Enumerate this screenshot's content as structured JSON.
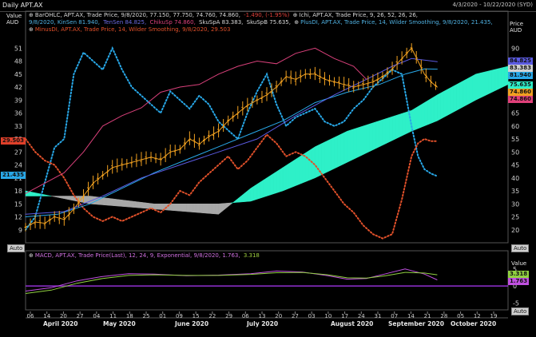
{
  "window": {
    "title": "Daily APT.AX",
    "date_range": "4/3/2020 - 10/22/2020 (SYD)"
  },
  "axes": {
    "left_title": "Value",
    "left_unit": "AUD",
    "right_title": "Price",
    "right_unit": "AUD",
    "macd_right_title": "Value",
    "auto_label": "Auto"
  },
  "legend": {
    "main_line1": [
      {
        "icon": "bar",
        "text": "BarOHLC, APT.AX, Trade Price, 9/8/2020, 77.150, 77.750, 74.760, 74.860, ",
        "color": "#d8d8d8"
      },
      {
        "icon": "none",
        "text": "-1.490, (-1.95%)",
        "color": "#e0403a"
      },
      {
        "icon": "ichi",
        "text": "Ichi, APT.AX, Trade Price,  9, 26, 52, 26, 26,",
        "color": "#d8d8d8"
      }
    ],
    "main_line2": [
      {
        "text": "9/8/2020, KinSen 81.940,",
        "color": "#4fb0e0"
      },
      {
        "text": "TenSen 84.825,",
        "color": "#6a6ae0"
      },
      {
        "text": "ChikuSp 74.860,",
        "color": "#d8407a"
      },
      {
        "text": "SkuSpA 83.383,",
        "color": "#d8d8d8"
      },
      {
        "text": "SkuSpB 75.635,",
        "color": "#d8d8d8"
      },
      {
        "text": "PlusDI, APT.AX, Trade Price, 14, Wilder Smoothing, 9/8/2020, 21.435,",
        "color": "#4fb0e0"
      }
    ],
    "main_line3": [
      {
        "text": "MinusDI, APT.AX, Trade Price, 14, Wilder Smoothing, 9/8/2020, 29.503",
        "color": "#e0502a"
      }
    ],
    "macd": [
      {
        "text": "MACD, APT.AX, Trade Price(Last), 12, 24, 9, Exponential, 9/8/2020, 1.763,",
        "color": "#d070e0"
      },
      {
        "text": "3.318",
        "color": "#a0d040"
      }
    ]
  },
  "badges": {
    "left": [
      {
        "text": "29.503",
        "value": 29.503,
        "bg": "#e0402a",
        "fg": "#111"
      },
      {
        "text": "21.435",
        "value": 21.435,
        "bg": "#28a8e8",
        "fg": "#111"
      }
    ],
    "right": [
      {
        "text": "84.825",
        "value": 84.825,
        "bg": "#5a5ae0",
        "fg": "#111"
      },
      {
        "text": "83.383",
        "value": 83.383,
        "bg": "#d0d0d0",
        "fg": "#111"
      },
      {
        "text": "81.940",
        "value": 81.94,
        "bg": "#28a8e8",
        "fg": "#111"
      },
      {
        "text": "75.635",
        "value": 75.635,
        "bg": "#2ef0c8",
        "fg": "#111"
      },
      {
        "text": "74.860",
        "value": 74.86,
        "bg": "#f0a020",
        "fg": "#111"
      },
      {
        "text": "74.860",
        "value": 74.86,
        "bg": "#e0407a",
        "fg": "#111"
      }
    ],
    "macd_right": [
      {
        "text": "3.318",
        "value": 3.318,
        "bg": "#90d040",
        "fg": "#111"
      },
      {
        "text": "1.763",
        "value": 1.763,
        "bg": "#c050e0",
        "fg": "#111"
      }
    ]
  },
  "chart_data": {
    "type": "line",
    "title": "Daily APT.AX",
    "left_axis": {
      "label": "Value AUD",
      "ticks": [
        9,
        12,
        15,
        18,
        21,
        24,
        27,
        30,
        33,
        36,
        39,
        42,
        45,
        48,
        51
      ],
      "range": [
        6,
        54
      ]
    },
    "right_axis": {
      "label": "Price AUD",
      "ticks": [
        20,
        25,
        30,
        35,
        40,
        45,
        50,
        55,
        60,
        65,
        70,
        75,
        80,
        85,
        90
      ],
      "range": [
        15,
        95
      ]
    },
    "x_ticks": [
      "06",
      "14",
      "20",
      "27",
      "04",
      "11",
      "18",
      "25",
      "01",
      "09",
      "15",
      "22",
      "29",
      "06",
      "13",
      "20",
      "27",
      "03",
      "10",
      "17",
      "24",
      "31",
      "07",
      "14",
      "21",
      "28",
      "05",
      "12",
      "19"
    ],
    "months": [
      "April 2020",
      "May 2020",
      "June 2020",
      "July 2020",
      "August 2020",
      "September 2020",
      "October 2020"
    ],
    "macd_axis": {
      "label": "Value",
      "ticks": [
        -5,
        0,
        5
      ],
      "range": [
        -7,
        8
      ]
    },
    "series": [
      {
        "name": "BarOHLC (Close)",
        "color": "#f0a020",
        "axis": "right",
        "points": [
          [
            0,
            21
          ],
          [
            3,
            23
          ],
          [
            6,
            22.5
          ],
          [
            9,
            25
          ],
          [
            12,
            24
          ],
          [
            15,
            28
          ],
          [
            18,
            33
          ],
          [
            21,
            38
          ],
          [
            24,
            41
          ],
          [
            27,
            44
          ],
          [
            30,
            45
          ],
          [
            33,
            46
          ],
          [
            36,
            47
          ],
          [
            39,
            48
          ],
          [
            42,
            47
          ],
          [
            45,
            50
          ],
          [
            48,
            51
          ],
          [
            51,
            55
          ],
          [
            54,
            53
          ],
          [
            57,
            56
          ],
          [
            60,
            58
          ],
          [
            63,
            62
          ],
          [
            66,
            65
          ],
          [
            69,
            68
          ],
          [
            72,
            70
          ],
          [
            75,
            72
          ],
          [
            78,
            75
          ],
          [
            81,
            79
          ],
          [
            84,
            78
          ],
          [
            87,
            80
          ],
          [
            90,
            80
          ],
          [
            93,
            78
          ],
          [
            96,
            77
          ],
          [
            99,
            76
          ],
          [
            102,
            75
          ],
          [
            105,
            76
          ],
          [
            108,
            77
          ],
          [
            111,
            79
          ],
          [
            114,
            82
          ],
          [
            117,
            86
          ],
          [
            120,
            90
          ],
          [
            122,
            85
          ],
          [
            124,
            80
          ],
          [
            126,
            77
          ],
          [
            128,
            75
          ]
        ]
      },
      {
        "name": "PlusDI",
        "color": "#28a8e8",
        "axis": "left",
        "points": [
          [
            0,
            9
          ],
          [
            3,
            12
          ],
          [
            6,
            20
          ],
          [
            9,
            28
          ],
          [
            12,
            30
          ],
          [
            15,
            45
          ],
          [
            18,
            50
          ],
          [
            21,
            48
          ],
          [
            24,
            46
          ],
          [
            27,
            51
          ],
          [
            30,
            46
          ],
          [
            33,
            42
          ],
          [
            36,
            40
          ],
          [
            39,
            38
          ],
          [
            42,
            36
          ],
          [
            45,
            41
          ],
          [
            48,
            39
          ],
          [
            51,
            37
          ],
          [
            54,
            40
          ],
          [
            57,
            38
          ],
          [
            60,
            34
          ],
          [
            63,
            32
          ],
          [
            66,
            30
          ],
          [
            69,
            36
          ],
          [
            72,
            41
          ],
          [
            75,
            45
          ],
          [
            78,
            38
          ],
          [
            81,
            33
          ],
          [
            84,
            35
          ],
          [
            87,
            36
          ],
          [
            90,
            37
          ],
          [
            93,
            34
          ],
          [
            96,
            33
          ],
          [
            99,
            34
          ],
          [
            102,
            37
          ],
          [
            105,
            39
          ],
          [
            108,
            42
          ],
          [
            111,
            44
          ],
          [
            114,
            46
          ],
          [
            117,
            45
          ],
          [
            120,
            33
          ],
          [
            122,
            26
          ],
          [
            124,
            23
          ],
          [
            126,
            22
          ],
          [
            128,
            21.4
          ]
        ]
      },
      {
        "name": "MinusDI",
        "color": "#e0502a",
        "axis": "left",
        "points": [
          [
            0,
            30
          ],
          [
            3,
            27
          ],
          [
            6,
            25
          ],
          [
            9,
            24
          ],
          [
            12,
            21
          ],
          [
            15,
            17
          ],
          [
            18,
            14
          ],
          [
            21,
            12
          ],
          [
            24,
            11
          ],
          [
            27,
            12
          ],
          [
            30,
            11
          ],
          [
            33,
            12
          ],
          [
            36,
            13
          ],
          [
            39,
            14
          ],
          [
            42,
            13
          ],
          [
            45,
            15
          ],
          [
            48,
            18
          ],
          [
            51,
            17
          ],
          [
            54,
            20
          ],
          [
            57,
            22
          ],
          [
            60,
            24
          ],
          [
            63,
            26
          ],
          [
            66,
            23
          ],
          [
            69,
            25
          ],
          [
            72,
            28
          ],
          [
            75,
            31
          ],
          [
            78,
            29
          ],
          [
            81,
            26
          ],
          [
            84,
            27
          ],
          [
            87,
            26
          ],
          [
            90,
            24
          ],
          [
            93,
            21
          ],
          [
            96,
            18
          ],
          [
            99,
            15
          ],
          [
            102,
            13
          ],
          [
            105,
            10
          ],
          [
            108,
            8
          ],
          [
            111,
            7
          ],
          [
            114,
            8
          ],
          [
            117,
            16
          ],
          [
            120,
            26
          ],
          [
            122,
            29
          ],
          [
            124,
            30
          ],
          [
            126,
            29.5
          ],
          [
            128,
            29.5
          ]
        ]
      },
      {
        "name": "KinSen",
        "color": "#28a8e8",
        "axis": "right",
        "points": [
          [
            0,
            25
          ],
          [
            10,
            26
          ],
          [
            20,
            30
          ],
          [
            30,
            36
          ],
          [
            40,
            42
          ],
          [
            50,
            47
          ],
          [
            60,
            52
          ],
          [
            70,
            57
          ],
          [
            80,
            62
          ],
          [
            90,
            69
          ],
          [
            100,
            73
          ],
          [
            110,
            76
          ],
          [
            118,
            80
          ],
          [
            124,
            82
          ],
          [
            128,
            81.9
          ]
        ]
      },
      {
        "name": "TenSen",
        "color": "#5a5ae0",
        "axis": "right",
        "points": [
          [
            0,
            26
          ],
          [
            12,
            27
          ],
          [
            24,
            33
          ],
          [
            36,
            40
          ],
          [
            48,
            45
          ],
          [
            60,
            50
          ],
          [
            72,
            55
          ],
          [
            84,
            64
          ],
          [
            96,
            72
          ],
          [
            106,
            78
          ],
          [
            114,
            83
          ],
          [
            120,
            86
          ],
          [
            128,
            84.8
          ]
        ]
      },
      {
        "name": "ChikuSp",
        "color": "#d8407a",
        "axis": "right",
        "points": [
          [
            0,
            34
          ],
          [
            6,
            38
          ],
          [
            12,
            42
          ],
          [
            18,
            50
          ],
          [
            24,
            60
          ],
          [
            30,
            64
          ],
          [
            36,
            67
          ],
          [
            42,
            73
          ],
          [
            48,
            75
          ],
          [
            54,
            76
          ],
          [
            60,
            80
          ],
          [
            66,
            83
          ],
          [
            72,
            85
          ],
          [
            78,
            84
          ],
          [
            84,
            88
          ],
          [
            90,
            90
          ],
          [
            96,
            86
          ],
          [
            102,
            83
          ],
          [
            106,
            78
          ]
        ]
      },
      {
        "name": "SkuSpA",
        "color": "#2ef0c8",
        "axis": "right",
        "fill": true,
        "points": [
          [
            0,
            35
          ],
          [
            20,
            30
          ],
          [
            40,
            28
          ],
          [
            50,
            27
          ],
          [
            60,
            26
          ],
          [
            70,
            36
          ],
          [
            80,
            44
          ],
          [
            90,
            52
          ],
          [
            100,
            58
          ],
          [
            110,
            62
          ],
          [
            120,
            66
          ],
          [
            128,
            72
          ],
          [
            140,
            80
          ],
          [
            150,
            83
          ]
        ]
      },
      {
        "name": "SkuSpB",
        "color": "#a0a0a0",
        "axis": "right",
        "fill": true,
        "points": [
          [
            0,
            33
          ],
          [
            20,
            33
          ],
          [
            40,
            30
          ],
          [
            50,
            30
          ],
          [
            60,
            30
          ],
          [
            70,
            31
          ],
          [
            80,
            35
          ],
          [
            90,
            40
          ],
          [
            100,
            46
          ],
          [
            110,
            52
          ],
          [
            120,
            58
          ],
          [
            128,
            62
          ],
          [
            140,
            70
          ],
          [
            150,
            76
          ]
        ]
      }
    ],
    "macd_series": [
      {
        "name": "MACD",
        "color": "#c050e0",
        "points": [
          [
            0,
            -1.5
          ],
          [
            8,
            -0.5
          ],
          [
            16,
            1.5
          ],
          [
            24,
            2.8
          ],
          [
            32,
            3.6
          ],
          [
            40,
            3.5
          ],
          [
            50,
            3.0
          ],
          [
            60,
            3.2
          ],
          [
            70,
            3.6
          ],
          [
            78,
            4.4
          ],
          [
            86,
            4.1
          ],
          [
            94,
            3.0
          ],
          [
            100,
            2.0
          ],
          [
            106,
            2.2
          ],
          [
            112,
            3.6
          ],
          [
            118,
            5.0
          ],
          [
            124,
            3.5
          ],
          [
            128,
            1.8
          ]
        ]
      },
      {
        "name": "Signal",
        "color": "#90d040",
        "points": [
          [
            0,
            -2.2
          ],
          [
            8,
            -1.2
          ],
          [
            16,
            0.8
          ],
          [
            24,
            2.2
          ],
          [
            32,
            3.1
          ],
          [
            40,
            3.3
          ],
          [
            50,
            3.1
          ],
          [
            60,
            3.1
          ],
          [
            70,
            3.4
          ],
          [
            78,
            3.9
          ],
          [
            86,
            4.0
          ],
          [
            94,
            3.3
          ],
          [
            100,
            2.4
          ],
          [
            106,
            2.3
          ],
          [
            112,
            3.0
          ],
          [
            118,
            4.0
          ],
          [
            124,
            3.8
          ],
          [
            128,
            3.3
          ]
        ]
      }
    ],
    "grid": false,
    "legend": "top-left"
  }
}
